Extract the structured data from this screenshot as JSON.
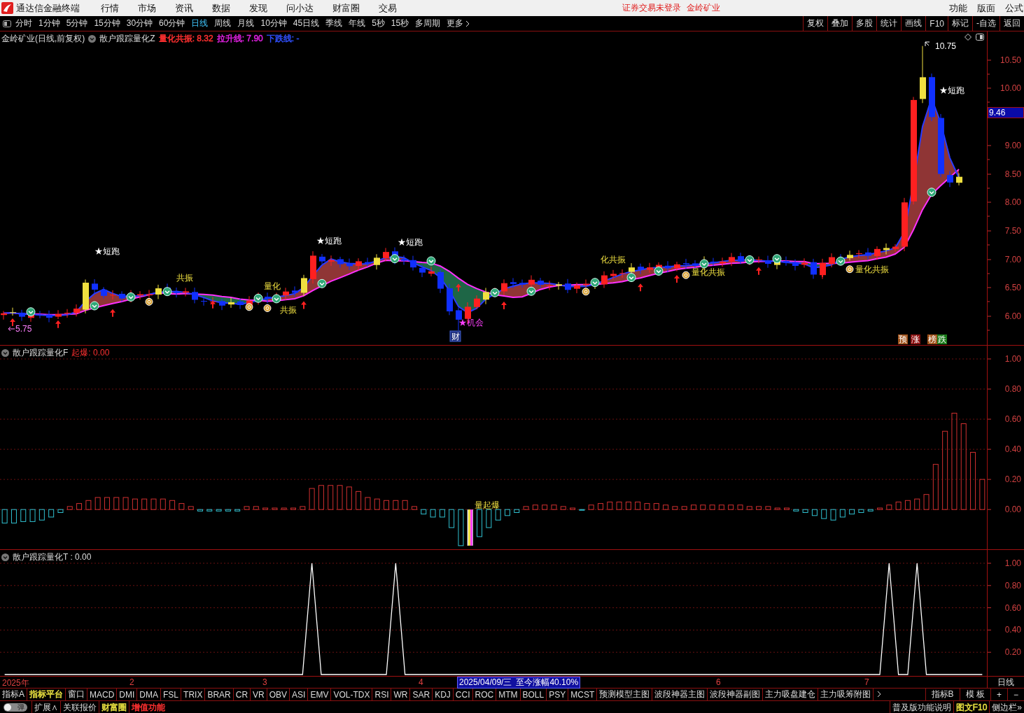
{
  "title_bar": {
    "app_name": "通达信金融终端",
    "menus": [
      "行情",
      "市场",
      "资讯",
      "数据",
      "发现",
      "问小达",
      "财富圈",
      "交易"
    ],
    "status_texts": [
      "证券交易未登录",
      "金岭矿业"
    ],
    "right_menus": [
      "功能",
      "版面",
      "公式"
    ]
  },
  "period_bar": {
    "periods": [
      {
        "label": "分时",
        "selected": false
      },
      {
        "label": "1分钟",
        "selected": false
      },
      {
        "label": "5分钟",
        "selected": false
      },
      {
        "label": "15分钟",
        "selected": false
      },
      {
        "label": "30分钟",
        "selected": false
      },
      {
        "label": "60分钟",
        "selected": false
      },
      {
        "label": "日线",
        "selected": true
      },
      {
        "label": "周线",
        "selected": false
      },
      {
        "label": "月线",
        "selected": false
      },
      {
        "label": "10分钟",
        "selected": false
      },
      {
        "label": "45日线",
        "selected": false
      },
      {
        "label": "季线",
        "selected": false
      },
      {
        "label": "年线",
        "selected": false
      },
      {
        "label": "5秒",
        "selected": false
      },
      {
        "label": "15秒",
        "selected": false
      },
      {
        "label": "多周期",
        "selected": false
      },
      {
        "label": "更多",
        "selected": false
      }
    ],
    "tools": [
      "复权",
      "叠加",
      "多股",
      "统计",
      "画线",
      "F10",
      "标记",
      "-自选",
      "返回"
    ]
  },
  "main_chart": {
    "stock_title": "金岭矿业(日线,前复权)",
    "indicator": "散户跟踪量化Z",
    "legend": [
      {
        "label": "量化共振: 8.32",
        "color": "#ff3030"
      },
      {
        "label": "拉升线: 7.90",
        "color": "#e020e0"
      },
      {
        "label": "下跌线: -",
        "color": "#3050ff"
      }
    ],
    "price_ticks": [
      "10.50",
      "10.00",
      "9.00",
      "8.50",
      "8.00",
      "7.50",
      "7.00",
      "6.50",
      "6.00"
    ],
    "price_tag": "9.46",
    "markers": [
      {
        "text": "5.75",
        "kind": "low"
      },
      {
        "text": "★短跑",
        "kind": "signal"
      },
      {
        "text": "共振",
        "kind": "resonance"
      },
      {
        "text": "量化",
        "kind": "resonance"
      },
      {
        "text": "共振",
        "kind": "resonance"
      },
      {
        "text": "★短跑",
        "kind": "signal"
      },
      {
        "text": "★短跑",
        "kind": "signal"
      },
      {
        "text": "★机会",
        "kind": "chance"
      },
      {
        "text": "财",
        "kind": "finance"
      },
      {
        "text": "化共振",
        "kind": "resonance"
      },
      {
        "text": "量化共振",
        "kind": "resonance"
      },
      {
        "text": "量化共振",
        "kind": "resonance"
      },
      {
        "text": "10.75",
        "kind": "high"
      },
      {
        "text": "★短跑",
        "kind": "signal"
      }
    ],
    "signal_badges": [
      {
        "text": "预",
        "color": "#a0521a"
      },
      {
        "text": "涨",
        "color": "#8b1010"
      },
      {
        "text": "榜",
        "color": "#a0521a"
      },
      {
        "text": "跌",
        "color": "#1a7a1a"
      }
    ]
  },
  "indicator_pane_1": {
    "title": "散户跟踪量化F",
    "value_label": "起爆: 0.00",
    "chart_data": {
      "type": "bar",
      "ylim": [
        -0.25,
        1.0
      ],
      "grid": true,
      "yticks": [
        {
          "value": 1,
          "label": "1.00"
        },
        {
          "value": 0.8,
          "label": "0.80"
        },
        {
          "value": 0.6,
          "label": "0.60"
        },
        {
          "value": 0.4,
          "label": "0.40"
        },
        {
          "value": 0.2,
          "label": "0.20"
        },
        {
          "value": 0,
          "label": "0.00"
        }
      ],
      "values": [
        -0.09,
        -0.09,
        -0.08,
        -0.08,
        -0.07,
        -0.05,
        -0.02,
        0.02,
        0.04,
        0.06,
        0.08,
        0.08,
        0.08,
        0.08,
        0.07,
        0.07,
        0.07,
        0.07,
        0.06,
        0.04,
        0.02,
        -0.01,
        -0.01,
        -0.01,
        -0.01,
        -0.01,
        0.02,
        0.02,
        0.01,
        0.01,
        0.01,
        0.01,
        0.02,
        0.14,
        0.16,
        0.16,
        0.16,
        0.15,
        0.12,
        0.08,
        0.07,
        0.06,
        0.06,
        0.06,
        0.02,
        -0.03,
        -0.05,
        -0.05,
        -0.12,
        -0.24,
        -0.24,
        -0.18,
        -0.12,
        -0.07,
        -0.04,
        -0.02,
        0.02,
        0.03,
        0.03,
        0.03,
        0.02,
        0.01,
        -0.005,
        0.03,
        0.04,
        0.05,
        0.05,
        0.05,
        0.05,
        0.04,
        0.04,
        0.03,
        0.02,
        0.02,
        0.03,
        0.03,
        0.03,
        0.03,
        0.03,
        0.03,
        0.02,
        0.02,
        0.02,
        0.01,
        0.01,
        -0.01,
        -0.02,
        -0.04,
        -0.06,
        -0.07,
        -0.05,
        -0.03,
        -0.02,
        -0.01,
        0.01,
        0.03,
        0.05,
        0.06,
        0.07,
        0.1,
        0.3,
        0.52,
        0.64,
        0.57,
        0.38,
        0.2
      ],
      "annotations": [
        {
          "text": "量起爆"
        }
      ]
    }
  },
  "indicator_pane_2": {
    "title": "散户跟踪量化T : 0.00",
    "chart_data": {
      "type": "line",
      "ylim": [
        0,
        1.0
      ],
      "grid": true,
      "yticks": [
        {
          "value": 1,
          "label": "1.00"
        },
        {
          "value": 0.8,
          "label": "0.80"
        },
        {
          "value": 0.6,
          "label": "0.60"
        },
        {
          "value": 0.4,
          "label": "0.40"
        },
        {
          "value": 0.2,
          "label": "0.20"
        }
      ],
      "series": [
        {
          "color": "#ffffff",
          "values": [
            0,
            0,
            0,
            0,
            0,
            0,
            0,
            0,
            0,
            0,
            0,
            0,
            0,
            0,
            0,
            0,
            0,
            0,
            0,
            0,
            0,
            0,
            0,
            0,
            0,
            0,
            0,
            0,
            0,
            0,
            0,
            0,
            0,
            1,
            0,
            0,
            0,
            0,
            0,
            0,
            0,
            0,
            1,
            0,
            0,
            0,
            0,
            0,
            0,
            0,
            0,
            0,
            0,
            0,
            0,
            0,
            0,
            0,
            0,
            0,
            0,
            0,
            0,
            0,
            0,
            0,
            0,
            0,
            0,
            0,
            0,
            0,
            0,
            0,
            0,
            0,
            0,
            0,
            0,
            0,
            0,
            0,
            0,
            0,
            0,
            0,
            0,
            0,
            0,
            0,
            0,
            0,
            0,
            0,
            0,
            1,
            0,
            0,
            1,
            0,
            0,
            0,
            0,
            0,
            0,
            0
          ]
        }
      ]
    }
  },
  "time_axis": {
    "labels": [
      "2025年",
      "2",
      "3",
      "4",
      "6",
      "7"
    ],
    "cursor_date": "2025/04/09/三",
    "cursor_change": "至今涨幅40.10%",
    "period": "日线"
  },
  "indicator_tabs": {
    "items": [
      {
        "label": "指标A"
      },
      {
        "label": "指标平台",
        "color": "#e8e040"
      },
      {
        "label": "窗口"
      },
      {
        "label": "MACD"
      },
      {
        "label": "DMI"
      },
      {
        "label": "DMA"
      },
      {
        "label": "FSL"
      },
      {
        "label": "TRIX"
      },
      {
        "label": "BRAR"
      },
      {
        "label": "CR"
      },
      {
        "label": "VR"
      },
      {
        "label": "OBV"
      },
      {
        "label": "ASI"
      },
      {
        "label": "EMV"
      },
      {
        "label": "VOL-TDX"
      },
      {
        "label": "RSI"
      },
      {
        "label": "WR"
      },
      {
        "label": "SAR"
      },
      {
        "label": "KDJ"
      },
      {
        "label": "CCI"
      },
      {
        "label": "ROC"
      },
      {
        "label": "MTM"
      },
      {
        "label": "BOLL"
      },
      {
        "label": "PSY"
      },
      {
        "label": "MCST"
      },
      {
        "label": "预测模型主图"
      },
      {
        "label": "波段神器主图"
      },
      {
        "label": "波段神器副图"
      },
      {
        "label": "主力吸盘建仓"
      },
      {
        "label": "主力吸筹附图"
      }
    ],
    "right": [
      "指标B",
      "模 板",
      "+",
      "−"
    ]
  },
  "bottom_bar": {
    "toggle": {
      "label": "弹",
      "on": false
    },
    "items": [
      {
        "label": "扩展∧"
      },
      {
        "label": "关联报价"
      },
      {
        "label": "财富圈",
        "color": "#e8e040"
      },
      {
        "label": "增值功能",
        "color": "#ff3030"
      }
    ],
    "right_items": [
      {
        "label": "普及版功能说明"
      },
      {
        "label": "图文F10",
        "color": "#e8e040"
      },
      {
        "label": "侧边栏»"
      }
    ]
  }
}
